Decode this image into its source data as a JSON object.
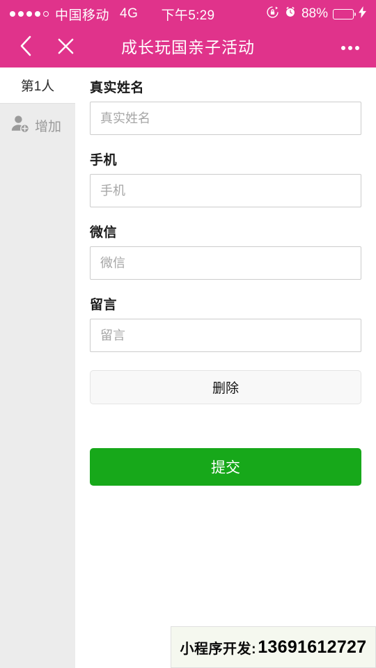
{
  "status_bar": {
    "signal_dots_total": 5,
    "signal_dots_filled": 4,
    "carrier": "中国移动",
    "network": "4G",
    "time": "下午5:29",
    "rotation_lock_icon": "rotation-lock-icon",
    "alarm_icon": "alarm-clock-icon",
    "battery_percent": "88%",
    "battery_level": 88,
    "battery_color": "#4cd964",
    "charging_icon": "lightning-bolt-icon",
    "background_color": "#e0338b"
  },
  "nav_bar": {
    "back_icon": "back-chevron-icon",
    "close_icon": "close-icon",
    "title": "成长玩国亲子活动",
    "more_icon": "more-options-icon",
    "background_color": "#e0338b"
  },
  "sidebar": {
    "tabs": [
      {
        "label": "第1人",
        "active": true
      }
    ],
    "add_button": {
      "icon": "person-add-icon",
      "label": "增加"
    },
    "background_color": "#ececec"
  },
  "form": {
    "fields": [
      {
        "label": "真实姓名",
        "placeholder": "真实姓名",
        "value": "",
        "name": "real-name"
      },
      {
        "label": "手机",
        "placeholder": "手机",
        "value": "",
        "name": "phone"
      },
      {
        "label": "微信",
        "placeholder": "微信",
        "value": "",
        "name": "wechat"
      },
      {
        "label": "留言",
        "placeholder": "留言",
        "value": "",
        "name": "message"
      }
    ],
    "delete_button": "删除",
    "submit_button": "提交",
    "submit_color": "#17a81a"
  },
  "watermark": {
    "label": "小程序开发:",
    "phone": "13691612727"
  }
}
